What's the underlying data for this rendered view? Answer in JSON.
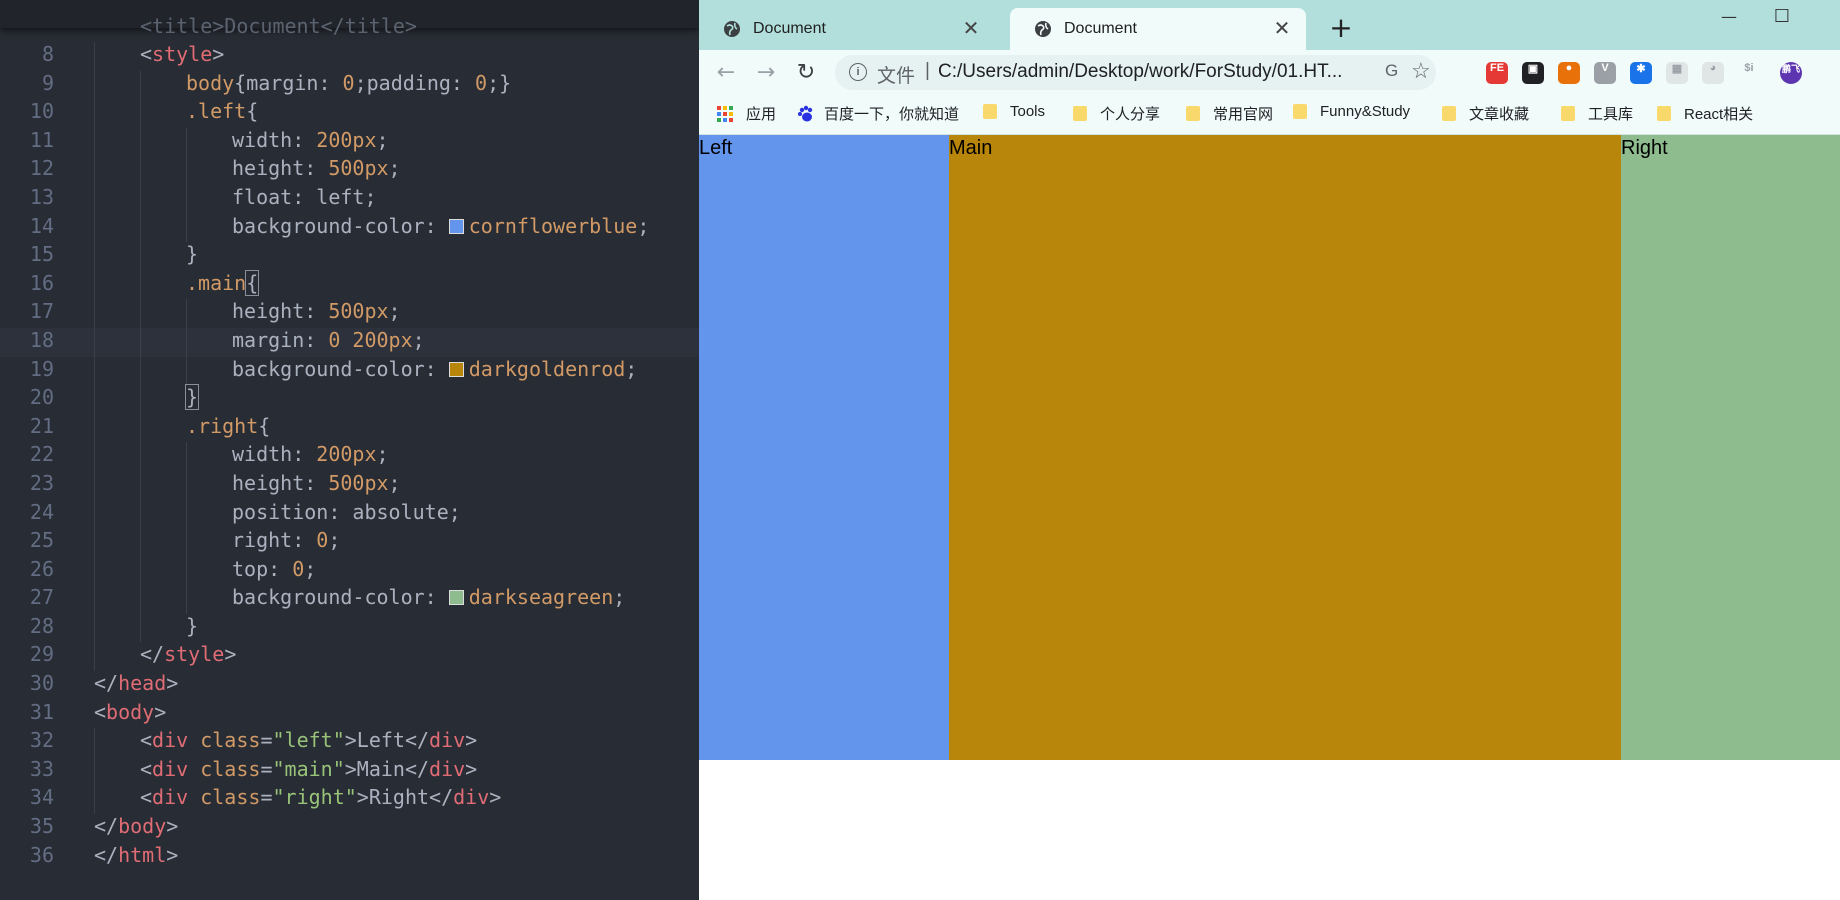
{
  "editor": {
    "partial_top_line": "<title>Document</title>",
    "lines": [
      {
        "n": "8",
        "indent": 1,
        "tokens": [
          [
            "tag-punct",
            "<"
          ],
          [
            "tag",
            "style"
          ],
          [
            "tag-punct",
            ">"
          ]
        ]
      },
      {
        "n": "9",
        "indent": 2,
        "tokens": [
          [
            "sel",
            "body"
          ],
          [
            "punct",
            "{margin: "
          ],
          [
            "num",
            "0"
          ],
          [
            "punct",
            ";padding: "
          ],
          [
            "num",
            "0"
          ],
          [
            "punct",
            ";}"
          ]
        ]
      },
      {
        "n": "10",
        "indent": 2,
        "tokens": [
          [
            "sel",
            ".left"
          ],
          [
            "punct",
            "{"
          ]
        ]
      },
      {
        "n": "11",
        "indent": 3,
        "tokens": [
          [
            "prop",
            "width: "
          ],
          [
            "num",
            "200px"
          ],
          [
            "punct",
            ";"
          ]
        ]
      },
      {
        "n": "12",
        "indent": 3,
        "tokens": [
          [
            "prop",
            "height: "
          ],
          [
            "num",
            "500px"
          ],
          [
            "punct",
            ";"
          ]
        ]
      },
      {
        "n": "13",
        "indent": 3,
        "tokens": [
          [
            "prop",
            "float: "
          ],
          [
            "prop",
            "left"
          ],
          [
            "punct",
            ";"
          ]
        ]
      },
      {
        "n": "14",
        "indent": 3,
        "tokens": [
          [
            "prop",
            "background-color: "
          ],
          [
            "swatch",
            "#6495ed"
          ],
          [
            "val",
            "cornflowerblue"
          ],
          [
            "punct",
            ";"
          ]
        ]
      },
      {
        "n": "15",
        "indent": 2,
        "tokens": [
          [
            "punct",
            "}"
          ]
        ]
      },
      {
        "n": "16",
        "indent": 2,
        "tokens": [
          [
            "sel",
            ".main"
          ],
          [
            "bracket",
            "{"
          ]
        ]
      },
      {
        "n": "17",
        "indent": 3,
        "tokens": [
          [
            "prop",
            "height: "
          ],
          [
            "num",
            "500px"
          ],
          [
            "punct",
            ";"
          ]
        ]
      },
      {
        "n": "18",
        "indent": 3,
        "active": true,
        "tokens": [
          [
            "prop",
            "margin: "
          ],
          [
            "num",
            "0 200px"
          ],
          [
            "punct",
            ";"
          ]
        ]
      },
      {
        "n": "19",
        "indent": 3,
        "tokens": [
          [
            "prop",
            "background-color: "
          ],
          [
            "swatch",
            "#b8860b"
          ],
          [
            "val",
            "darkgoldenrod"
          ],
          [
            "punct",
            ";"
          ]
        ]
      },
      {
        "n": "20",
        "indent": 2,
        "tokens": [
          [
            "bracket",
            "}"
          ]
        ]
      },
      {
        "n": "21",
        "indent": 2,
        "tokens": [
          [
            "sel",
            ".right"
          ],
          [
            "punct",
            "{"
          ]
        ]
      },
      {
        "n": "22",
        "indent": 3,
        "tokens": [
          [
            "prop",
            "width: "
          ],
          [
            "num",
            "200px"
          ],
          [
            "punct",
            ";"
          ]
        ]
      },
      {
        "n": "23",
        "indent": 3,
        "tokens": [
          [
            "prop",
            "height: "
          ],
          [
            "num",
            "500px"
          ],
          [
            "punct",
            ";"
          ]
        ]
      },
      {
        "n": "24",
        "indent": 3,
        "tokens": [
          [
            "prop",
            "position: "
          ],
          [
            "prop",
            "absolute"
          ],
          [
            "punct",
            ";"
          ]
        ]
      },
      {
        "n": "25",
        "indent": 3,
        "tokens": [
          [
            "prop",
            "right: "
          ],
          [
            "num",
            "0"
          ],
          [
            "punct",
            ";"
          ]
        ]
      },
      {
        "n": "26",
        "indent": 3,
        "tokens": [
          [
            "prop",
            "top: "
          ],
          [
            "num",
            "0"
          ],
          [
            "punct",
            ";"
          ]
        ]
      },
      {
        "n": "27",
        "indent": 3,
        "tokens": [
          [
            "prop",
            "background-color: "
          ],
          [
            "swatch",
            "#8fbc8f"
          ],
          [
            "val",
            "darkseagreen"
          ],
          [
            "punct",
            ";"
          ]
        ]
      },
      {
        "n": "28",
        "indent": 2,
        "tokens": [
          [
            "punct",
            "}"
          ]
        ]
      },
      {
        "n": "29",
        "indent": 1,
        "tokens": [
          [
            "tag-punct",
            "</"
          ],
          [
            "tag",
            "style"
          ],
          [
            "tag-punct",
            ">"
          ]
        ]
      },
      {
        "n": "30",
        "indent": 0,
        "tokens": [
          [
            "tag-punct",
            "</"
          ],
          [
            "tag",
            "head"
          ],
          [
            "tag-punct",
            ">"
          ]
        ]
      },
      {
        "n": "31",
        "indent": 0,
        "tokens": [
          [
            "tag-punct",
            "<"
          ],
          [
            "tag",
            "body"
          ],
          [
            "tag-punct",
            ">"
          ]
        ]
      },
      {
        "n": "32",
        "indent": 1,
        "tokens": [
          [
            "tag-punct",
            "<"
          ],
          [
            "tag",
            "div"
          ],
          [
            "punct",
            " "
          ],
          [
            "attr",
            "class"
          ],
          [
            "punct",
            "="
          ],
          [
            "str",
            "\"left\""
          ],
          [
            "tag-punct",
            ">"
          ],
          [
            "text",
            "Left"
          ],
          [
            "tag-punct",
            "</"
          ],
          [
            "tag",
            "div"
          ],
          [
            "tag-punct",
            ">"
          ]
        ]
      },
      {
        "n": "33",
        "indent": 1,
        "tokens": [
          [
            "tag-punct",
            "<"
          ],
          [
            "tag",
            "div"
          ],
          [
            "punct",
            " "
          ],
          [
            "attr",
            "class"
          ],
          [
            "punct",
            "="
          ],
          [
            "str",
            "\"main\""
          ],
          [
            "tag-punct",
            ">"
          ],
          [
            "text",
            "Main"
          ],
          [
            "tag-punct",
            "</"
          ],
          [
            "tag",
            "div"
          ],
          [
            "tag-punct",
            ">"
          ]
        ]
      },
      {
        "n": "34",
        "indent": 1,
        "tokens": [
          [
            "tag-punct",
            "<"
          ],
          [
            "tag",
            "div"
          ],
          [
            "punct",
            " "
          ],
          [
            "attr",
            "class"
          ],
          [
            "punct",
            "="
          ],
          [
            "str",
            "\"right\""
          ],
          [
            "tag-punct",
            ">"
          ],
          [
            "text",
            "Right"
          ],
          [
            "tag-punct",
            "</"
          ],
          [
            "tag",
            "div"
          ],
          [
            "tag-punct",
            ">"
          ]
        ]
      },
      {
        "n": "35",
        "indent": 0,
        "tokens": [
          [
            "tag-punct",
            "</"
          ],
          [
            "tag",
            "body"
          ],
          [
            "tag-punct",
            ">"
          ]
        ]
      },
      {
        "n": "36",
        "indent": 0,
        "tokens": [
          [
            "tag-punct",
            "</"
          ],
          [
            "tag",
            "html"
          ],
          [
            "tag-punct",
            ">"
          ]
        ]
      }
    ]
  },
  "browser": {
    "tabs": [
      {
        "title": "Document",
        "close": "✕"
      },
      {
        "title": "Document",
        "close": "✕"
      }
    ],
    "new_tab": "+",
    "window_controls": {
      "minimize": "—",
      "maximize": "☐"
    },
    "nav": {
      "back": "←",
      "forward": "→",
      "reload": "↻"
    },
    "omnibox": {
      "info": "i",
      "scheme": "文件",
      "separator": "|",
      "url": "C:/Users/admin/Desktop/work/ForStudy/01.HT...",
      "translate": "G",
      "star": "☆"
    },
    "extensions": [
      {
        "label": "FE",
        "color": "#e53935"
      },
      {
        "label": "▣",
        "color": "#202124"
      },
      {
        "label": "●",
        "color": "#e8710a"
      },
      {
        "label": "V",
        "color": "#9aa0a6"
      },
      {
        "label": "✱",
        "color": "#1a73e8"
      },
      {
        "label": "▦",
        "color": "#dfe6e5"
      },
      {
        "label": "◕",
        "color": "#dfe6e5"
      },
      {
        "label": "$i",
        "color": "#f0fbfa"
      },
      {
        "label": "鹏飞",
        "color": "#5e35b1"
      }
    ],
    "bookmarks": [
      {
        "label": "应用",
        "icon": "apps-grid-icon"
      },
      {
        "label": "百度一下，你就知道",
        "icon": "baidu-paw-icon"
      },
      {
        "label": "Tools",
        "icon": "folder-icon"
      },
      {
        "label": "个人分享",
        "icon": "folder-icon"
      },
      {
        "label": "常用官网",
        "icon": "folder-icon"
      },
      {
        "label": "Funny&Study",
        "icon": "folder-icon"
      },
      {
        "label": "文章收藏",
        "icon": "folder-icon"
      },
      {
        "label": "工具库",
        "icon": "folder-icon"
      },
      {
        "label": "React相关",
        "icon": "folder-icon"
      }
    ],
    "page": {
      "left": {
        "text": "Left",
        "color": "#6495ed"
      },
      "main": {
        "text": "Main",
        "color": "#b8860b"
      },
      "right": {
        "text": "Right",
        "color": "#8fbc8f"
      }
    }
  }
}
